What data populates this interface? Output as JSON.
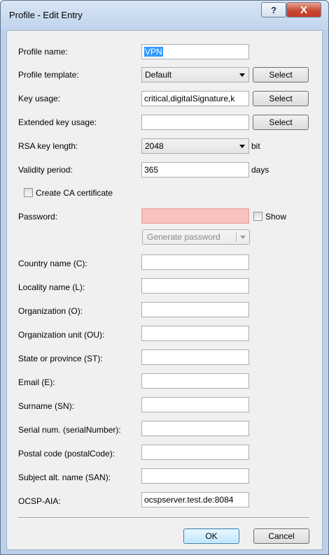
{
  "window": {
    "title": "Profile - Edit Entry",
    "help_label": "?",
    "close_label": "X"
  },
  "form": {
    "profile_name": {
      "label": "Profile name:",
      "value": "VPN"
    },
    "profile_template": {
      "label": "Profile template:",
      "value": "Default",
      "button": "Select"
    },
    "key_usage": {
      "label": "Key usage:",
      "value": "critical,digitalSignature,k",
      "button": "Select"
    },
    "extended_key_usage": {
      "label": "Extended key usage:",
      "value": "",
      "button": "Select"
    },
    "rsa_key_length": {
      "label": "RSA key length:",
      "value": "2048",
      "unit": "bit"
    },
    "validity_period": {
      "label": "Validity period:",
      "value": "365",
      "unit": "days"
    },
    "create_ca": {
      "label": "Create CA certificate",
      "checked": false
    },
    "password": {
      "label": "Password:",
      "value": "",
      "show_label": "Show",
      "show_checked": false
    },
    "generate_password": {
      "label": "Generate password"
    },
    "country": {
      "label": "Country name (C):",
      "value": ""
    },
    "locality": {
      "label": "Locality name (L):",
      "value": ""
    },
    "organization": {
      "label": "Organization (O):",
      "value": ""
    },
    "org_unit": {
      "label": "Organization unit (OU):",
      "value": ""
    },
    "state": {
      "label": "State or province (ST):",
      "value": ""
    },
    "email": {
      "label": "Email (E):",
      "value": ""
    },
    "surname": {
      "label": "Surname (SN):",
      "value": ""
    },
    "serial": {
      "label": "Serial num. (serialNumber):",
      "value": ""
    },
    "postal": {
      "label": "Postal code (postalCode):",
      "value": ""
    },
    "san": {
      "label": "Subject alt. name (SAN):",
      "value": ""
    },
    "ocsp": {
      "label": "OCSP-AIA:",
      "value": "ocspserver.test.de:8084"
    }
  },
  "footer": {
    "ok_label": "OK",
    "cancel_label": "Cancel"
  },
  "colors": {
    "password_field_bg": "#f9c0c0",
    "selection_bg": "#3399ff",
    "ok_border": "#3c7fb1"
  }
}
